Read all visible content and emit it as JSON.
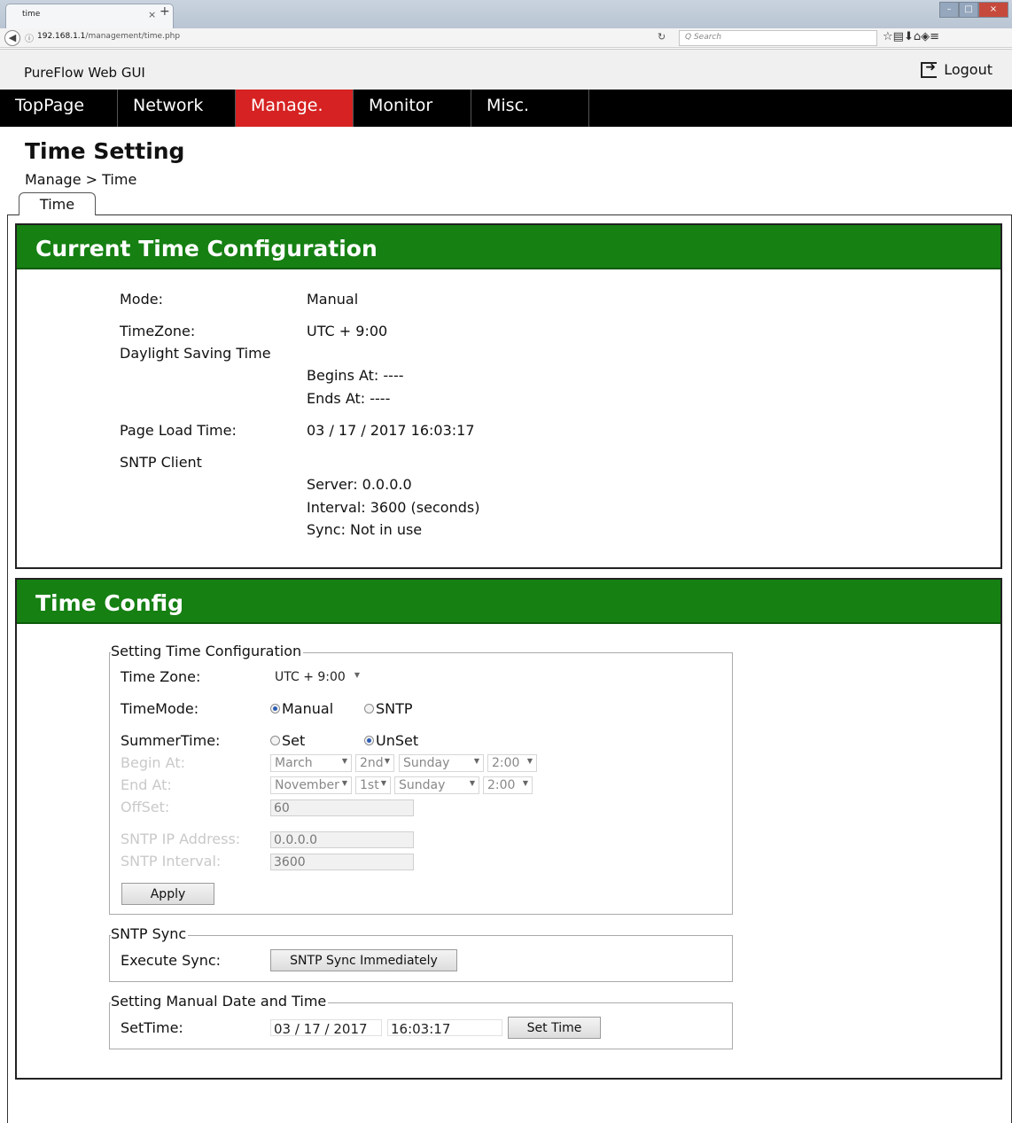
{
  "browser": {
    "tab_title": "time",
    "tab_close": "×",
    "new_tab": "+",
    "url_host": "192.168.1.1",
    "url_path": "/management/time.php",
    "search_placeholder": "Q Search"
  },
  "app": {
    "title": "PureFlow Web GUI",
    "logout_label": "Logout"
  },
  "menu": {
    "items": [
      "TopPage",
      "Network",
      "Manage.",
      "Monitor",
      "Misc."
    ],
    "active": "Manage."
  },
  "page": {
    "title": "Time Setting",
    "breadcrumb": "Manage > Time",
    "subtab": "Time"
  },
  "current": {
    "heading": "Current Time Configuration",
    "mode_label": "Mode:",
    "mode_value": "Manual",
    "tz_label": "TimeZone:",
    "tz_value": "UTC + 9:00",
    "dst_label": "Daylight Saving Time",
    "dst_begins": "Begins At: ----",
    "dst_ends": "Ends At: ----",
    "load_label": "Page Load Time:",
    "load_value": "03 / 17 / 2017 16:03:17",
    "sntp_label": "SNTP Client",
    "sntp_server": "Server: 0.0.0.0",
    "sntp_interval": "Interval: 3600 (seconds)",
    "sntp_sync": "Sync: Not in use"
  },
  "config": {
    "heading": "Time Config",
    "setting": {
      "legend": "Setting Time Configuration",
      "tz_label": "Time Zone:",
      "tz_value": "UTC + 9:00",
      "mode_label": "TimeMode:",
      "mode_manual": "Manual",
      "mode_sntp": "SNTP",
      "mode_selected": "Manual",
      "summer_label": "SummerTime:",
      "summer_set": "Set",
      "summer_unset": "UnSet",
      "summer_selected": "UnSet",
      "begin_label": "Begin At:",
      "begin_month": "March",
      "begin_week": "2nd",
      "begin_day": "Sunday",
      "begin_time": "2:00",
      "end_label": "End At:",
      "end_month": "November",
      "end_week": "1st",
      "end_day": "Sunday",
      "end_time": "2:00",
      "offset_label": "OffSet:",
      "offset_value": "60",
      "sntp_ip_label": "SNTP IP Address:",
      "sntp_ip_value": "0.0.0.0",
      "sntp_interval_label": "SNTP Interval:",
      "sntp_interval_value": "3600",
      "apply_label": "Apply"
    },
    "sync": {
      "legend": "SNTP Sync",
      "exec_label": "Execute Sync:",
      "button_label": "SNTP Sync Immediately"
    },
    "manual": {
      "legend": "Setting Manual Date and Time",
      "set_label": "SetTime:",
      "date_value": "03 / 17 / 2017",
      "time_value": "16:03:17",
      "button_label": "Set Time"
    }
  }
}
